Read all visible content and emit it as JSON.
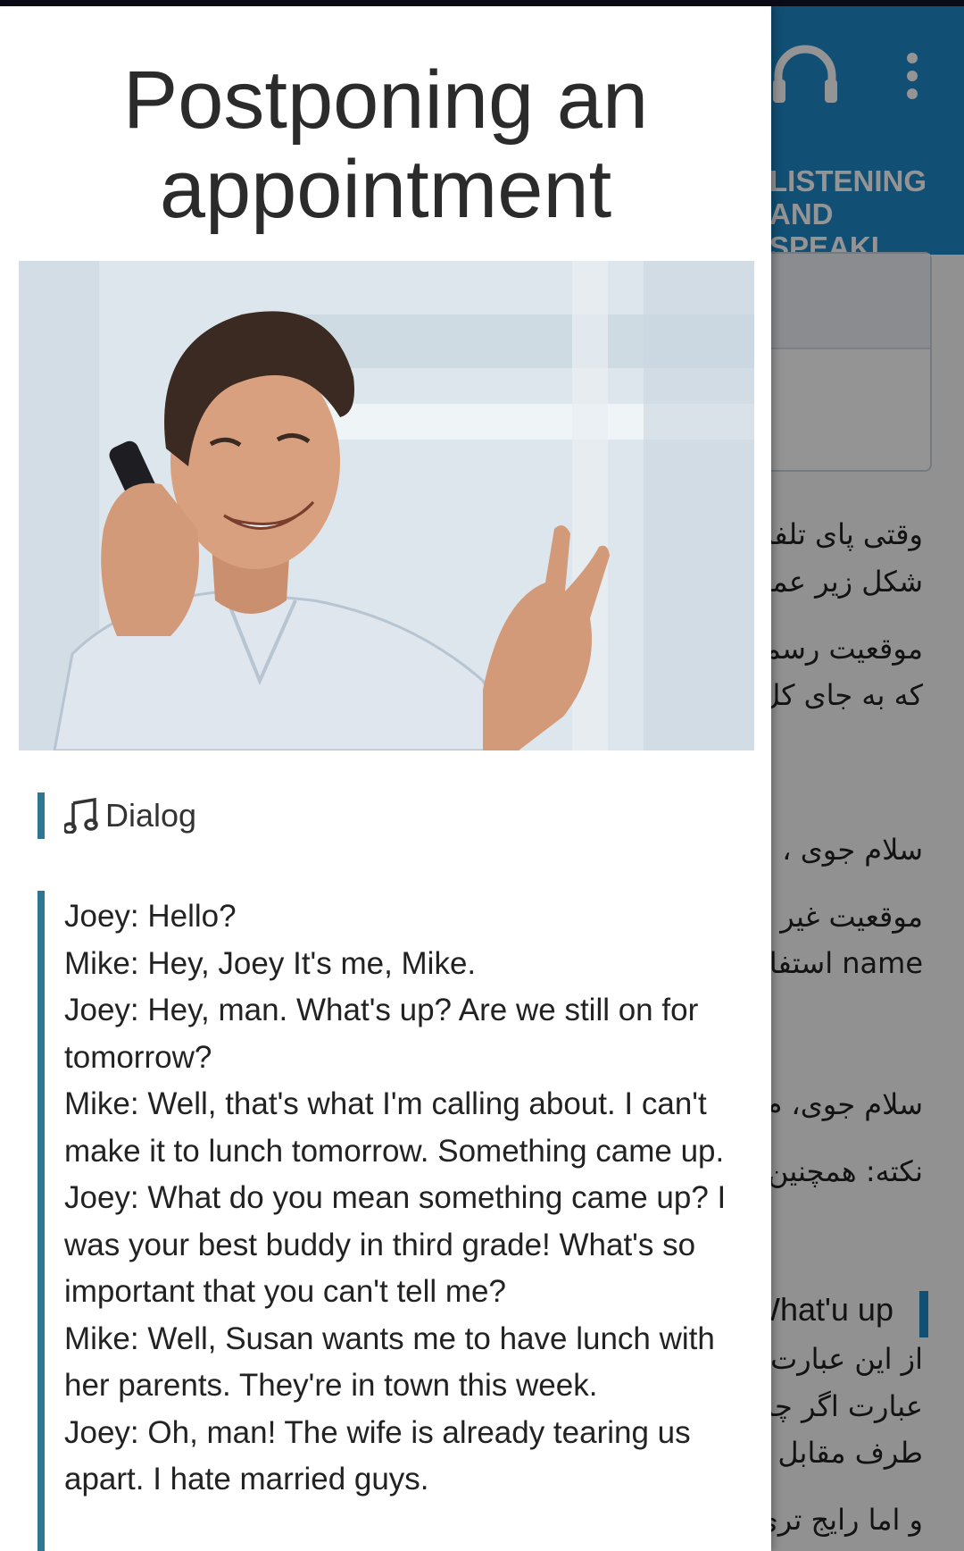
{
  "background_app": {
    "tab_label": "LISTENING\nAND SPEAKI...",
    "toolbar_icons": [
      "headphones-icon",
      "more-vert-icon"
    ],
    "text_lines": [
      "وقتی پای تلفن",
      "شکل زیر عمل",
      "موقعیت رسمی",
      "که به جای کل",
      "سلام جوی ، م",
      "موقعیت غیر",
      "name استفاد",
      "سلام جوی، م",
      "نکته: همچنین",
      "از این عبارت",
      "عبارت اگر چه",
      "طرف مقابل ه",
      "و اما رایج تری"
    ],
    "whatsup_heading": "What'u up",
    "accent_color": "#1e88c8"
  },
  "drawer": {
    "title": "Postponing an appointment",
    "image_alt": "Smiling man talking on a mobile phone",
    "section": {
      "icon": "music-note-icon",
      "label": "Dialog"
    },
    "dialog_lines": [
      "Joey: Hello?",
      "Mike: Hey, Joey It's me, Mike.",
      "Joey: Hey, man. What's up? Are we still on for tomorrow?",
      "Mike: Well, that's what I'm calling about. I can't make it to lunch tomorrow. Something came up.",
      "Joey: What do you mean something came up? I was your best buddy in third grade! What's so important that you can't tell me?",
      "Mike: Well, Susan wants me to have lunch with her parents. They're in town this week.",
      "Joey: Oh, man! The wife is already tearing us apart. I hate married guys."
    ],
    "accent_color": "#2e7691"
  }
}
